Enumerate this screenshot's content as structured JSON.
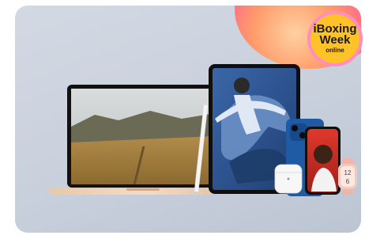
{
  "badge": {
    "line1": "iBoxing",
    "line2": "Week",
    "line3": "online"
  },
  "device_icons": [
    "laptop-icon",
    "tablet-icon",
    "stylus-icon",
    "earbuds-icon",
    "phone-icon",
    "watch-icon"
  ],
  "colors": {
    "background": "#c8d0dc",
    "badge": "#ffc227",
    "accent_gradient": "#ff6a8a"
  }
}
